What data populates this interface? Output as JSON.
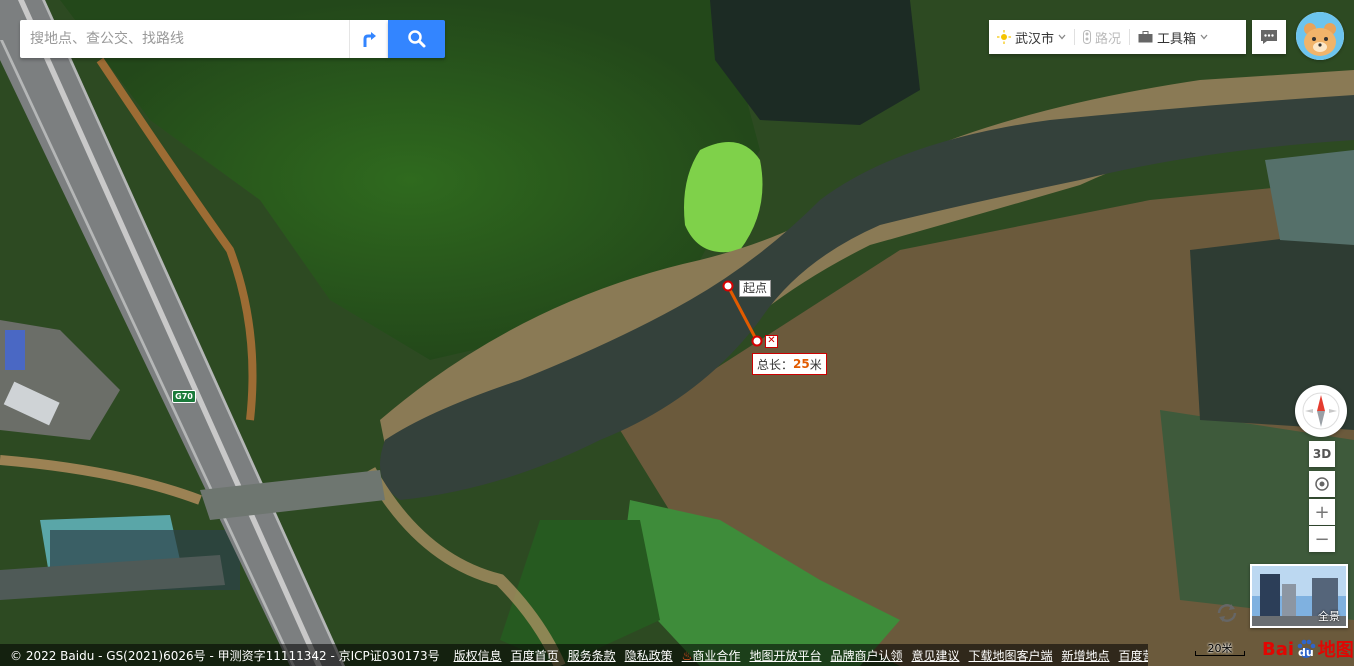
{
  "search": {
    "placeholder": "搜地点、查公交、找路线"
  },
  "toolbar": {
    "city_label": "武汉市",
    "traffic_label": "路况",
    "toolbox_label": "工具箱"
  },
  "measurement": {
    "start_label": "起点",
    "total_prefix": "总长：",
    "total_value": "25",
    "total_unit": "米",
    "close_label": "✕"
  },
  "road": {
    "shield_label": "G70"
  },
  "controls": {
    "threeD_label": "3D",
    "zoom_in_label": "+",
    "zoom_out_label": "−"
  },
  "pano": {
    "label": "全景"
  },
  "scale": {
    "label": "20米"
  },
  "logo": {
    "text_a": "Bai",
    "text_b": "du",
    "text_c": "地图"
  },
  "footer": {
    "copyright": "© 2022 Baidu - GS(2021)6026号 - 甲测资字11111342 - 京ICP证030173号",
    "links": [
      "版权信息",
      "百度首页",
      "服务条款",
      "隐私政策",
      "商业合作",
      "地图开放平台",
      "品牌商户认领",
      "意见建议",
      "下载地图客户端",
      "新增地点",
      "百度营销"
    ]
  },
  "colors": {
    "accent": "#3385ff",
    "measure_line": "#e25b00",
    "logo_red": "#e10602"
  }
}
